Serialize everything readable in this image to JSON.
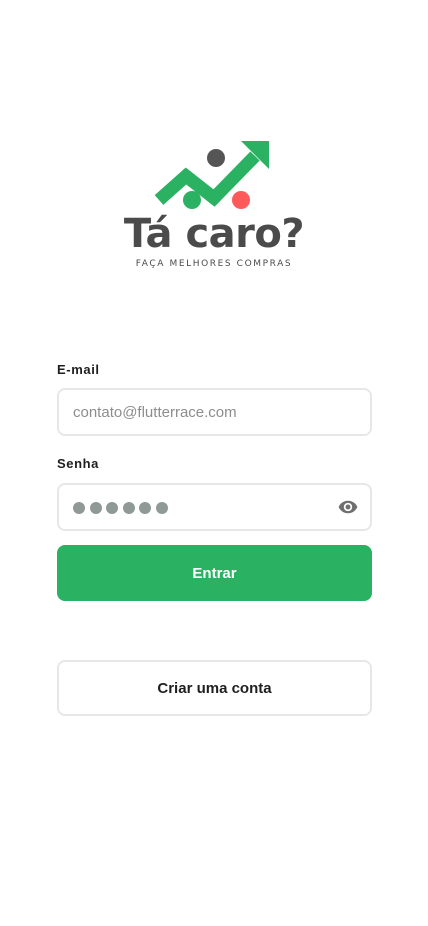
{
  "logo": {
    "title": "Tá caro?",
    "tagline": "FAÇA MELHORES COMPRAS",
    "colors": {
      "green": "#2ab162",
      "dark": "#555555",
      "red": "#ff5a5a"
    }
  },
  "form": {
    "email": {
      "label": "E-mail",
      "placeholder": "contato@flutterrace.com",
      "value": ""
    },
    "password": {
      "label": "Senha",
      "masked_length": 6,
      "toggle_icon": "eye-icon"
    }
  },
  "actions": {
    "login_label": "Entrar",
    "signup_label": "Criar uma conta"
  },
  "colors": {
    "primary": "#2ab162",
    "border": "#e7e7e7",
    "text": "#1f1f1f",
    "placeholder": "#8d8d8d"
  }
}
